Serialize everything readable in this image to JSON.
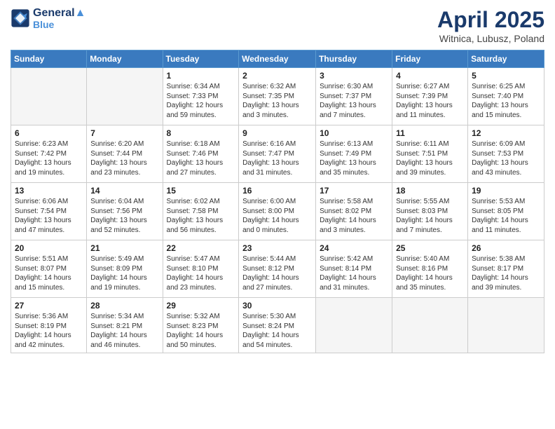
{
  "header": {
    "logo_line1": "General",
    "logo_line2": "Blue",
    "month": "April 2025",
    "location": "Witnica, Lubusz, Poland"
  },
  "days_of_week": [
    "Sunday",
    "Monday",
    "Tuesday",
    "Wednesday",
    "Thursday",
    "Friday",
    "Saturday"
  ],
  "weeks": [
    [
      {
        "day": "",
        "info": ""
      },
      {
        "day": "",
        "info": ""
      },
      {
        "day": "1",
        "info": "Sunrise: 6:34 AM\nSunset: 7:33 PM\nDaylight: 12 hours and 59 minutes."
      },
      {
        "day": "2",
        "info": "Sunrise: 6:32 AM\nSunset: 7:35 PM\nDaylight: 13 hours and 3 minutes."
      },
      {
        "day": "3",
        "info": "Sunrise: 6:30 AM\nSunset: 7:37 PM\nDaylight: 13 hours and 7 minutes."
      },
      {
        "day": "4",
        "info": "Sunrise: 6:27 AM\nSunset: 7:39 PM\nDaylight: 13 hours and 11 minutes."
      },
      {
        "day": "5",
        "info": "Sunrise: 6:25 AM\nSunset: 7:40 PM\nDaylight: 13 hours and 15 minutes."
      }
    ],
    [
      {
        "day": "6",
        "info": "Sunrise: 6:23 AM\nSunset: 7:42 PM\nDaylight: 13 hours and 19 minutes."
      },
      {
        "day": "7",
        "info": "Sunrise: 6:20 AM\nSunset: 7:44 PM\nDaylight: 13 hours and 23 minutes."
      },
      {
        "day": "8",
        "info": "Sunrise: 6:18 AM\nSunset: 7:46 PM\nDaylight: 13 hours and 27 minutes."
      },
      {
        "day": "9",
        "info": "Sunrise: 6:16 AM\nSunset: 7:47 PM\nDaylight: 13 hours and 31 minutes."
      },
      {
        "day": "10",
        "info": "Sunrise: 6:13 AM\nSunset: 7:49 PM\nDaylight: 13 hours and 35 minutes."
      },
      {
        "day": "11",
        "info": "Sunrise: 6:11 AM\nSunset: 7:51 PM\nDaylight: 13 hours and 39 minutes."
      },
      {
        "day": "12",
        "info": "Sunrise: 6:09 AM\nSunset: 7:53 PM\nDaylight: 13 hours and 43 minutes."
      }
    ],
    [
      {
        "day": "13",
        "info": "Sunrise: 6:06 AM\nSunset: 7:54 PM\nDaylight: 13 hours and 47 minutes."
      },
      {
        "day": "14",
        "info": "Sunrise: 6:04 AM\nSunset: 7:56 PM\nDaylight: 13 hours and 52 minutes."
      },
      {
        "day": "15",
        "info": "Sunrise: 6:02 AM\nSunset: 7:58 PM\nDaylight: 13 hours and 56 minutes."
      },
      {
        "day": "16",
        "info": "Sunrise: 6:00 AM\nSunset: 8:00 PM\nDaylight: 14 hours and 0 minutes."
      },
      {
        "day": "17",
        "info": "Sunrise: 5:58 AM\nSunset: 8:02 PM\nDaylight: 14 hours and 3 minutes."
      },
      {
        "day": "18",
        "info": "Sunrise: 5:55 AM\nSunset: 8:03 PM\nDaylight: 14 hours and 7 minutes."
      },
      {
        "day": "19",
        "info": "Sunrise: 5:53 AM\nSunset: 8:05 PM\nDaylight: 14 hours and 11 minutes."
      }
    ],
    [
      {
        "day": "20",
        "info": "Sunrise: 5:51 AM\nSunset: 8:07 PM\nDaylight: 14 hours and 15 minutes."
      },
      {
        "day": "21",
        "info": "Sunrise: 5:49 AM\nSunset: 8:09 PM\nDaylight: 14 hours and 19 minutes."
      },
      {
        "day": "22",
        "info": "Sunrise: 5:47 AM\nSunset: 8:10 PM\nDaylight: 14 hours and 23 minutes."
      },
      {
        "day": "23",
        "info": "Sunrise: 5:44 AM\nSunset: 8:12 PM\nDaylight: 14 hours and 27 minutes."
      },
      {
        "day": "24",
        "info": "Sunrise: 5:42 AM\nSunset: 8:14 PM\nDaylight: 14 hours and 31 minutes."
      },
      {
        "day": "25",
        "info": "Sunrise: 5:40 AM\nSunset: 8:16 PM\nDaylight: 14 hours and 35 minutes."
      },
      {
        "day": "26",
        "info": "Sunrise: 5:38 AM\nSunset: 8:17 PM\nDaylight: 14 hours and 39 minutes."
      }
    ],
    [
      {
        "day": "27",
        "info": "Sunrise: 5:36 AM\nSunset: 8:19 PM\nDaylight: 14 hours and 42 minutes."
      },
      {
        "day": "28",
        "info": "Sunrise: 5:34 AM\nSunset: 8:21 PM\nDaylight: 14 hours and 46 minutes."
      },
      {
        "day": "29",
        "info": "Sunrise: 5:32 AM\nSunset: 8:23 PM\nDaylight: 14 hours and 50 minutes."
      },
      {
        "day": "30",
        "info": "Sunrise: 5:30 AM\nSunset: 8:24 PM\nDaylight: 14 hours and 54 minutes."
      },
      {
        "day": "",
        "info": ""
      },
      {
        "day": "",
        "info": ""
      },
      {
        "day": "",
        "info": ""
      }
    ]
  ]
}
